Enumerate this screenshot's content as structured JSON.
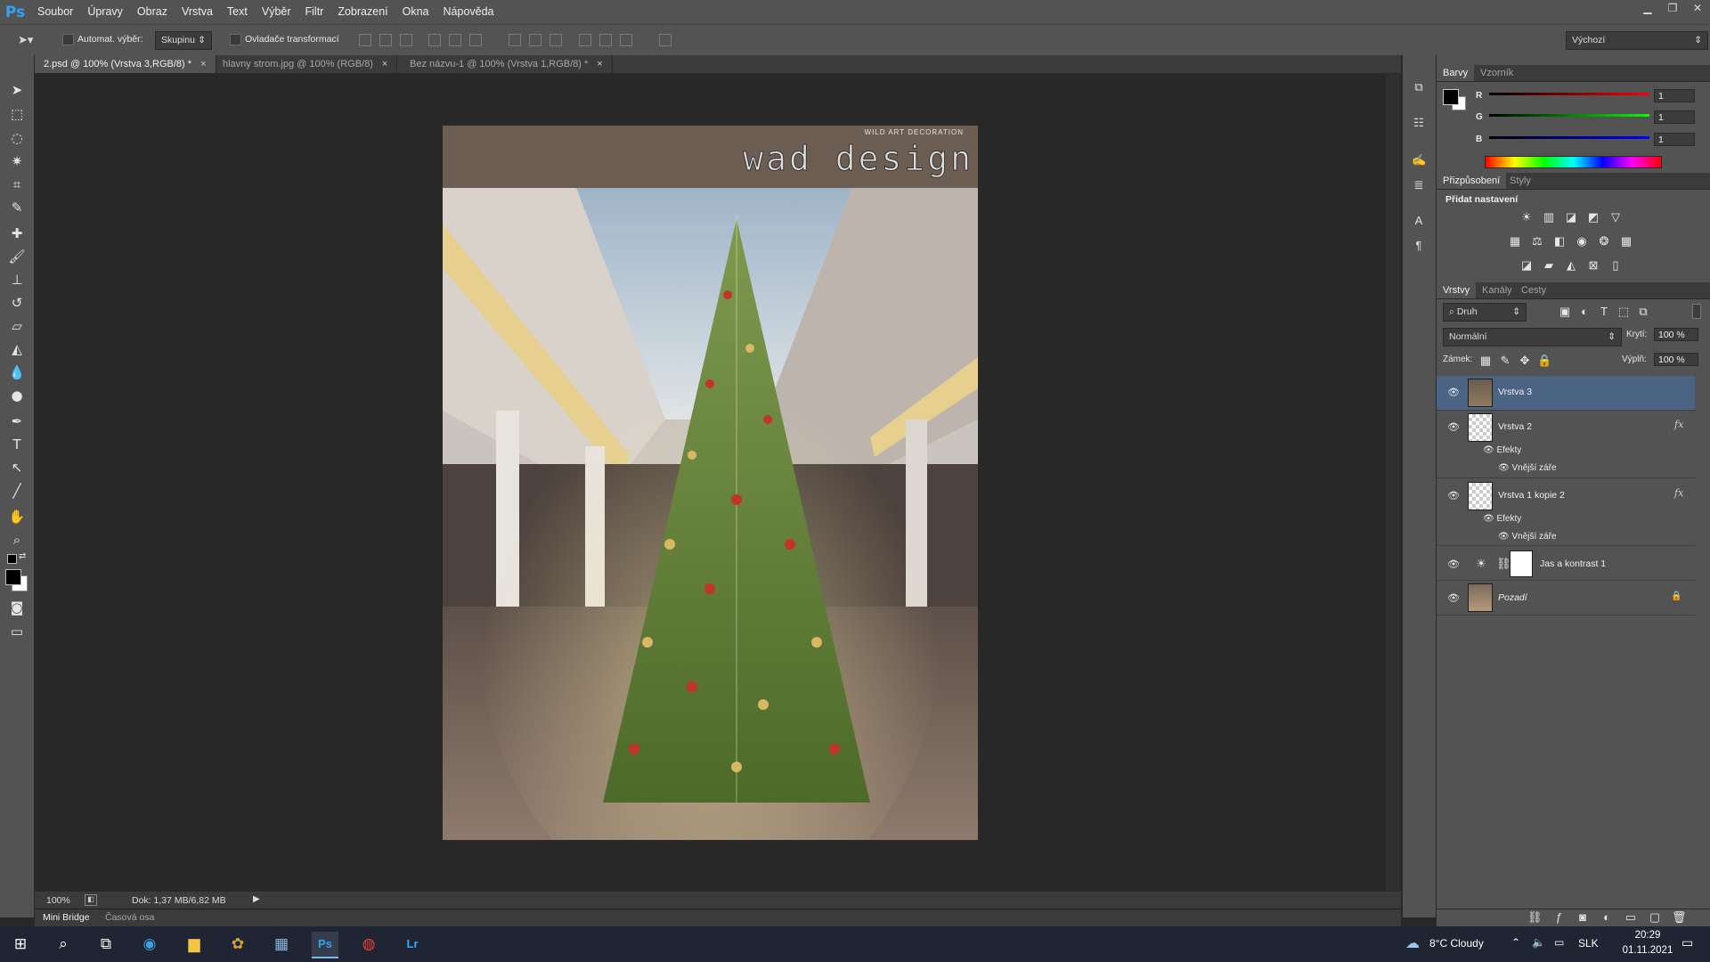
{
  "app": {
    "logo": "Ps"
  },
  "menu": [
    "Soubor",
    "Úpravy",
    "Obraz",
    "Vrstva",
    "Text",
    "Výběr",
    "Filtr",
    "Zobrazení",
    "Okna",
    "Nápověda"
  ],
  "window_controls": {
    "minimize": "▁",
    "restore": "❐",
    "close": "✕"
  },
  "options_bar": {
    "auto_select_label": "Automat. výběr:",
    "auto_select_value": "Skupinu",
    "transform_controls_label": "Ovladače transformací",
    "workspace_value": "Výchozí"
  },
  "tabs": [
    {
      "label": "2.psd @ 100% (Vrstva 3,RGB/8) *",
      "close": "×"
    },
    {
      "label": "hlavny strom.jpg @ 100% (RGB/8)",
      "close": "×"
    },
    {
      "label": "Bez názvu-1 @ 100% (Vrstva 1,RGB/8) *",
      "close": "×"
    }
  ],
  "document": {
    "logo_caption": "WILD ART DECORATION",
    "logo_text": "wad design"
  },
  "status": {
    "zoom": "100%",
    "doc_info": "Dok: 1,37 MB/6,82 MB"
  },
  "bottom_tabs": [
    "Mini Bridge",
    "Časová osa"
  ],
  "color_panel": {
    "tabs": [
      "Barvy",
      "Vzorník"
    ],
    "channels": [
      {
        "label": "R",
        "value": "1"
      },
      {
        "label": "G",
        "value": "1"
      },
      {
        "label": "B",
        "value": "1"
      }
    ]
  },
  "adjustments_panel": {
    "tabs": [
      "Přizpůsobení",
      "Styly"
    ],
    "heading": "Přidat nastavení"
  },
  "layers_panel": {
    "tabs": [
      "Vrstvy",
      "Kanály",
      "Cesty"
    ],
    "filter_kind": "Druh",
    "blend_mode": "Normální",
    "opacity_label": "Krytí:",
    "opacity_value": "100 %",
    "lock_label": "Zámek:",
    "fill_label": "Výplň:",
    "fill_value": "100 %",
    "layers": [
      {
        "name": "Vrstva 3"
      },
      {
        "name": "Vrstva 2",
        "fx": "fx",
        "effects_label": "Efekty",
        "effect": "Vnější záře"
      },
      {
        "name": "Vrstva 1 kopie 2",
        "fx": "fx",
        "effects_label": "Efekty",
        "effect": "Vnější záře"
      },
      {
        "name": "Jas a kontrast 1"
      },
      {
        "name": "Pozadí"
      }
    ]
  },
  "taskbar": {
    "weather": "8°C  Cloudy",
    "language": "SLK",
    "time": "20:29",
    "date": "01.11.2021"
  },
  "colors": {
    "selected_layer": "#4b6483",
    "ps_blue": "#2fa3f5",
    "taskbar": "#1f2533"
  }
}
